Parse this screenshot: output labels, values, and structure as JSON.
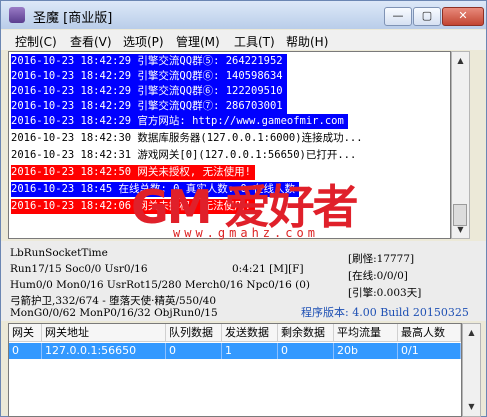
{
  "window": {
    "title": "圣魔 [商业版]",
    "btn_min": "—",
    "btn_max": "▢",
    "btn_close": "✕"
  },
  "menu": [
    "控制(C)",
    "查看(V)",
    "选项(P)",
    "管理(M)",
    "工具(T)",
    "帮助(H)"
  ],
  "colors": {
    "sel_bg": "#0000ff",
    "err_bg": "#ff0000",
    "ver_text": "#1e50b4"
  },
  "log": [
    {
      "text": "2016-10-23 18:42:29 引擎交流QQ群⑤: 264221952",
      "style": "sel"
    },
    {
      "text": "2016-10-23 18:42:29 引擎交流QQ群⑥: 140598634",
      "style": "sel"
    },
    {
      "text": "2016-10-23 18:42:29 引擎交流QQ群⑥: 122209510",
      "style": "sel"
    },
    {
      "text": "2016-10-23 18:42:29 引擎交流QQ群⑦: 286703001",
      "style": "sel"
    },
    {
      "text": "2016-10-23 18:42:29 官方网站: http://www.gameofmir.com",
      "style": "sel"
    },
    {
      "text": "2016-10-23 18:42:30 数据库服务器(127.0.0.1:6000)连接成功...",
      "style": "normal"
    },
    {
      "text": "2016-10-23 18:42:31 游戏网关[0](127.0.0.1:56650)已打开...",
      "style": "normal"
    },
    {
      "text": "2016-10-23 18:42:50 网关未授权, 无法使用!",
      "style": "err"
    },
    {
      "text": "2016-10-23 18:45   在线总数: 0  真实人数: 0  在线人数",
      "style": "sel"
    },
    {
      "text": "2016-10-23 18:42:06 网关未授权, 无法使用!",
      "style": "err"
    }
  ],
  "watermark": {
    "logo": "GM 爱好者",
    "url": "www.gmahz.com"
  },
  "info": {
    "title": "LbRunSocketTime",
    "run": "Run17/15 Soc0/0 Usr0/16",
    "clock": "0:4:21 [M][F]",
    "hum": "Hum0/0 Mon0/16 UsrRot15/280 Merch0/16 Npc0/16 (0)",
    "role": "弓箭护卫,332/674 - 堕落天使·精英/550/40",
    "mon": "MonG0/0/62 MonP0/16/32 ObjRun0/15",
    "refresh": "[刷怪:17777]",
    "online": "[在线:0/0/0]",
    "engine": "[引擎:0.003天]",
    "version": "程序版本: 4.00 Build 20150325"
  },
  "table": {
    "headers": [
      "网关",
      "网关地址",
      "队列数据",
      "发送数据",
      "剩余数据",
      "平均流量",
      "最高人数"
    ],
    "rows": [
      [
        "0",
        "127.0.0.1:56650",
        "0",
        "1",
        "0",
        "20b",
        "0/1"
      ]
    ]
  }
}
